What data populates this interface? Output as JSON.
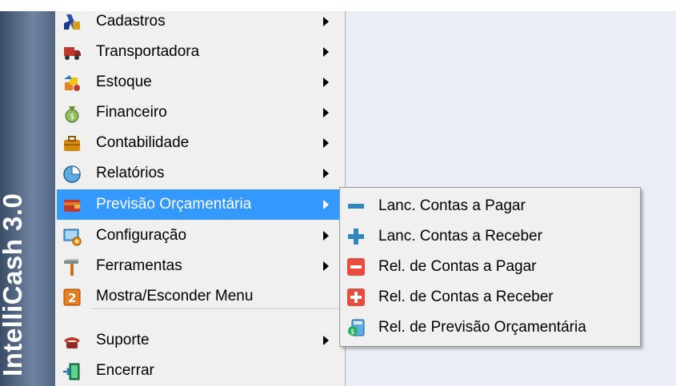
{
  "banner": {
    "title": "IntelliCash 3.0"
  },
  "menu": {
    "items": [
      {
        "label": "Cadastros",
        "icon": "registry-icon",
        "has_submenu": true
      },
      {
        "label": "Transportadora",
        "icon": "truck-icon",
        "has_submenu": true
      },
      {
        "label": "Estoque",
        "icon": "stock-icon",
        "has_submenu": true
      },
      {
        "label": "Financeiro",
        "icon": "money-bag-icon",
        "has_submenu": true
      },
      {
        "label": "Contabilidade",
        "icon": "briefcase-icon",
        "has_submenu": true
      },
      {
        "label": "Relatórios",
        "icon": "pie-chart-icon",
        "has_submenu": true
      },
      {
        "label": "Previsão Orçamentária",
        "icon": "wallet-icon",
        "has_submenu": true,
        "highlighted": true
      },
      {
        "label": "Configuração",
        "icon": "settings-icon",
        "has_submenu": true
      },
      {
        "label": "Ferramentas",
        "icon": "hammer-icon",
        "has_submenu": true
      },
      {
        "label": "Mostra/Esconder Menu",
        "icon": "toggle-menu-icon",
        "has_submenu": false
      },
      {
        "label": "Suporte",
        "icon": "telephone-icon",
        "has_submenu": true
      },
      {
        "label": "Encerrar",
        "icon": "exit-door-icon",
        "has_submenu": false
      }
    ]
  },
  "submenu": {
    "items": [
      {
        "label": "Lanc. Contas a Pagar",
        "icon": "minus-icon"
      },
      {
        "label": "Lanc. Contas a Receber",
        "icon": "plus-icon"
      },
      {
        "label": "Rel. de Contas a Pagar",
        "icon": "minus-box-icon"
      },
      {
        "label": "Rel. de Contas a Receber",
        "icon": "plus-box-icon"
      },
      {
        "label": "Rel. de Previsão Orçamentária",
        "icon": "budget-calculator-icon"
      }
    ]
  },
  "colors": {
    "highlight": "#3399ff",
    "banner": "#5a6f8d",
    "menu_bg": "#f0f0f0",
    "desktop": "#e9eef6"
  }
}
